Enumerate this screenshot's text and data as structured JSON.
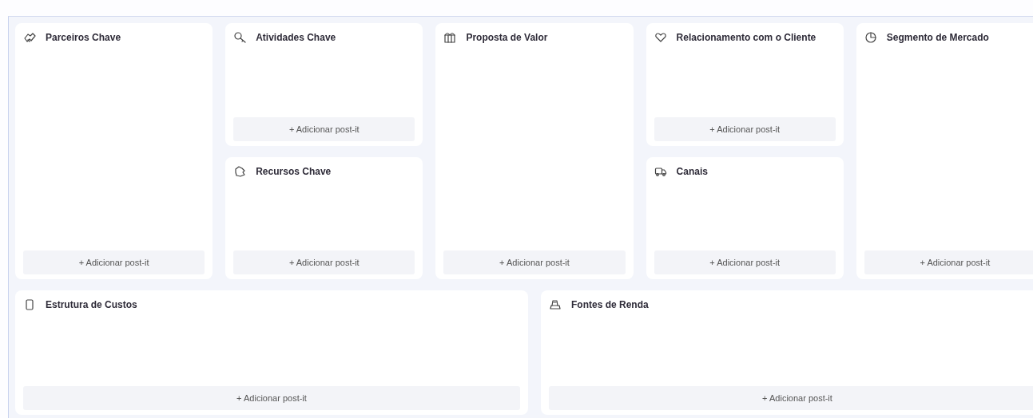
{
  "blocks": [
    {
      "kind": "partners",
      "title": "Parceiros Chave",
      "add_label": "+ Adicionar post-it"
    },
    {
      "kind": "activities",
      "title": "Atividades Chave",
      "add_label": "+ Adicionar post-it"
    },
    {
      "kind": "resources",
      "title": "Recursos Chave",
      "add_label": "+ Adicionar post-it"
    },
    {
      "kind": "value",
      "title": "Proposta de Valor",
      "add_label": "+ Adicionar post-it"
    },
    {
      "kind": "relationship",
      "title": "Relacionamento com o Cliente",
      "add_label": "+ Adicionar post-it"
    },
    {
      "kind": "channels",
      "title": "Canais",
      "add_label": "+ Adicionar post-it"
    },
    {
      "kind": "segments",
      "title": "Segmento de Mercado",
      "add_label": "+ Adicionar post-it"
    },
    {
      "kind": "costs",
      "title": "Estrutura de Custos",
      "add_label": "+ Adicionar post-it"
    },
    {
      "kind": "revenue",
      "title": "Fontes de Renda",
      "add_label": "+ Adicionar post-it"
    }
  ]
}
